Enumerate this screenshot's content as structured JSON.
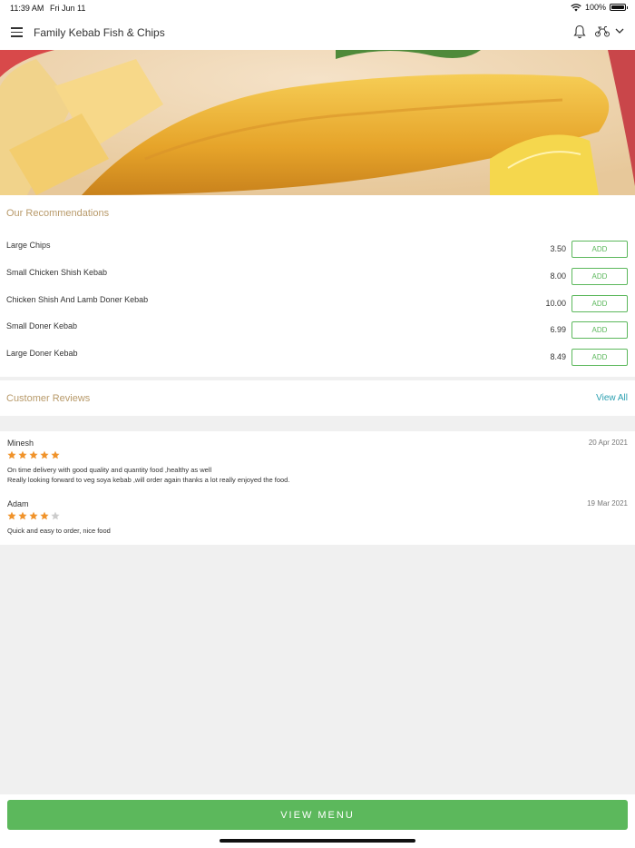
{
  "status_bar": {
    "time": "11:39 AM",
    "date": "Fri Jun 11",
    "battery": "100%",
    "battery_level": 1.0
  },
  "nav": {
    "title": "Family Kebab Fish & Chips"
  },
  "recommendations": {
    "title": "Our Recommendations",
    "add_label": "ADD",
    "items": [
      {
        "name": "Large Chips",
        "price": "3.50"
      },
      {
        "name": "Small Chicken Shish Kebab",
        "price": "8.00"
      },
      {
        "name": "Chicken Shish And Lamb Doner Kebab",
        "price": "10.00"
      },
      {
        "name": "Small Doner Kebab",
        "price": "6.99"
      },
      {
        "name": "Large Doner Kebab",
        "price": "8.49"
      }
    ]
  },
  "reviews": {
    "title": "Customer Reviews",
    "view_all": "View All",
    "items": [
      {
        "name": "Minesh",
        "date": "20 Apr 2021",
        "rating": 5,
        "max": 5,
        "lines": [
          "On time delivery with good quality and quantity food ,healthy as well",
          "Really looking forward to veg soya kebab ,will order again thanks a lot really enjoyed the food."
        ]
      },
      {
        "name": "Adam",
        "date": "19 Mar 2021",
        "rating": 4,
        "max": 5,
        "lines": [
          "Quick and easy to order, nice food"
        ]
      }
    ]
  },
  "footer": {
    "view_menu": "VIEW MENU"
  },
  "colors": {
    "accent_green": "#5cb85c",
    "section_title": "#b89a6a",
    "link": "#2a9fb0",
    "star_filled": "#f0932b",
    "star_empty": "#cccccc"
  }
}
